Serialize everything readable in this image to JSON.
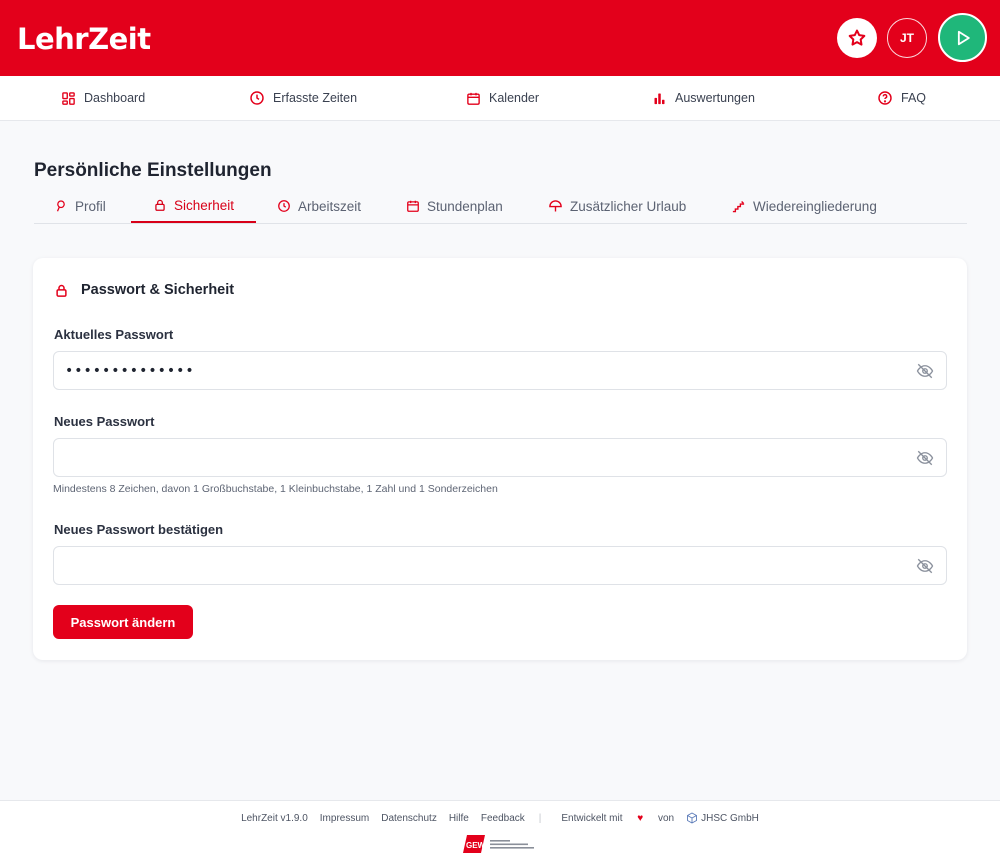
{
  "app": {
    "logo_text": "LehrZeit",
    "avatar_initials": "JT"
  },
  "nav": {
    "items": [
      {
        "label": "Dashboard",
        "icon": "grid-icon"
      },
      {
        "label": "Erfasste Zeiten",
        "icon": "clock-icon"
      },
      {
        "label": "Kalender",
        "icon": "calendar-icon"
      },
      {
        "label": "Auswertungen",
        "icon": "bar-chart-icon"
      },
      {
        "label": "FAQ",
        "icon": "help-circle-icon"
      }
    ]
  },
  "page": {
    "title": "Persönliche Einstellungen"
  },
  "tabs": [
    {
      "label": "Profil",
      "icon": "user-icon"
    },
    {
      "label": "Sicherheit",
      "icon": "lock-icon",
      "active": true
    },
    {
      "label": "Arbeitszeit",
      "icon": "clock-icon"
    },
    {
      "label": "Stundenplan",
      "icon": "calendar-icon"
    },
    {
      "label": "Zusätzlicher Urlaub",
      "icon": "umbrella-icon"
    },
    {
      "label": "Wiedereingliederung",
      "icon": "stairs-icon"
    }
  ],
  "card": {
    "title": "Passwort & Sicherheit",
    "current_password": {
      "label": "Aktuelles Passwort",
      "value": "••••••••••••••"
    },
    "new_password": {
      "label": "Neues Passwort",
      "value": "",
      "hint": "Mindestens 8 Zeichen, davon 1 Großbuchstabe, 1 Kleinbuchstabe, 1 Zahl und 1 Sonderzeichen"
    },
    "confirm_password": {
      "label": "Neues Passwort bestätigen",
      "value": ""
    },
    "submit_label": "Passwort ändern"
  },
  "footer": {
    "version": "LehrZeit v1.9.0",
    "links": [
      "Impressum",
      "Datenschutz",
      "Hilfe",
      "Feedback"
    ],
    "developed_prefix": "Entwickelt mit",
    "developed_by_word": "von",
    "company": "JHSC GmbH",
    "gew_mark": "GEW"
  },
  "colors": {
    "brand_red": "#e3001b",
    "play_green": "#1fb77a"
  }
}
